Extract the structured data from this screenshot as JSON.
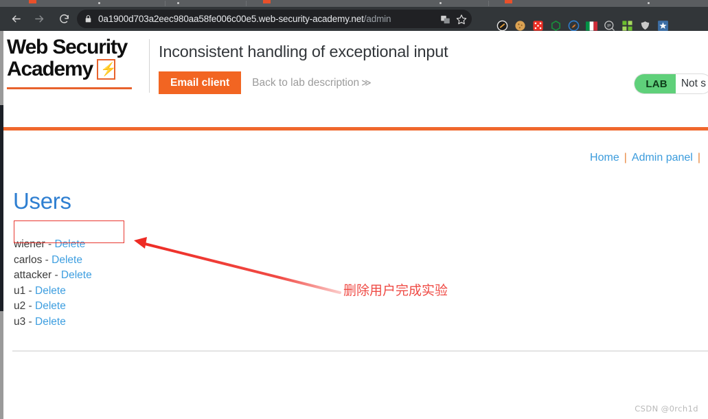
{
  "browser": {
    "back_icon": "back-arrow-icon",
    "forward_icon": "forward-arrow-icon",
    "reload_icon": "reload-icon",
    "lock_icon": "lock-icon",
    "url_host": "0a1900d703a2eec980aa58fe006c00e5.web-security-academy.net",
    "url_path": "/admin",
    "omnibox_icons": [
      "translate-icon",
      "bookmark-star-icon"
    ],
    "extensions": [
      {
        "name": "noscript-icon",
        "glyph": "⛔",
        "color": "#e8e8e8"
      },
      {
        "name": "cookie-icon",
        "glyph": "●",
        "color": "#d9a14a"
      },
      {
        "name": "dice-icon",
        "glyph": "⚄",
        "color": "#e8352b"
      },
      {
        "name": "hexagon-icon",
        "glyph": "⬡",
        "color": "#28a745"
      },
      {
        "name": "brush-circle-icon",
        "glyph": "●",
        "color": "#2f7fd1"
      },
      {
        "name": "italy-flag-icon",
        "glyph": "▮",
        "color": "#009246"
      },
      {
        "name": "ip-lookup-icon",
        "glyph": "IP",
        "color": "#cfcfcf"
      },
      {
        "name": "qr-grid-icon",
        "glyph": "▓",
        "color": "#7ac943"
      },
      {
        "name": "shield-icon",
        "glyph": "●",
        "color": "#c9c9c9"
      },
      {
        "name": "blue-star-icon",
        "glyph": "★",
        "color": "#4a90d9"
      }
    ]
  },
  "lab": {
    "logo_line1": "Web Security",
    "logo_line2": "Academy",
    "title": "Inconsistent handling of exceptional input",
    "email_client_label": "Email client",
    "back_link_label": "Back to lab description",
    "back_link_chevrons": "≫",
    "badge_label": "LAB",
    "status_text": "Not s",
    "accent_color": "#f26522",
    "badge_color": "#5fd07a"
  },
  "nav": {
    "links": [
      "Home",
      "Admin panel"
    ],
    "separator": "|",
    "trailing_separator": "|"
  },
  "main": {
    "heading": "Users",
    "delete_label": "Delete",
    "dash": " - ",
    "users": [
      {
        "name": "wiener"
      },
      {
        "name": "carlos"
      },
      {
        "name": "attacker"
      },
      {
        "name": "u1"
      },
      {
        "name": "u2"
      },
      {
        "name": "u3"
      }
    ]
  },
  "annotation": {
    "text": "删除用户完成实验",
    "color": "#ef4b45",
    "arrow_name": "red-arrow-annotation",
    "rect_name": "red-highlight-rectangle"
  },
  "watermark": {
    "text": "CSDN @0rch1d"
  }
}
